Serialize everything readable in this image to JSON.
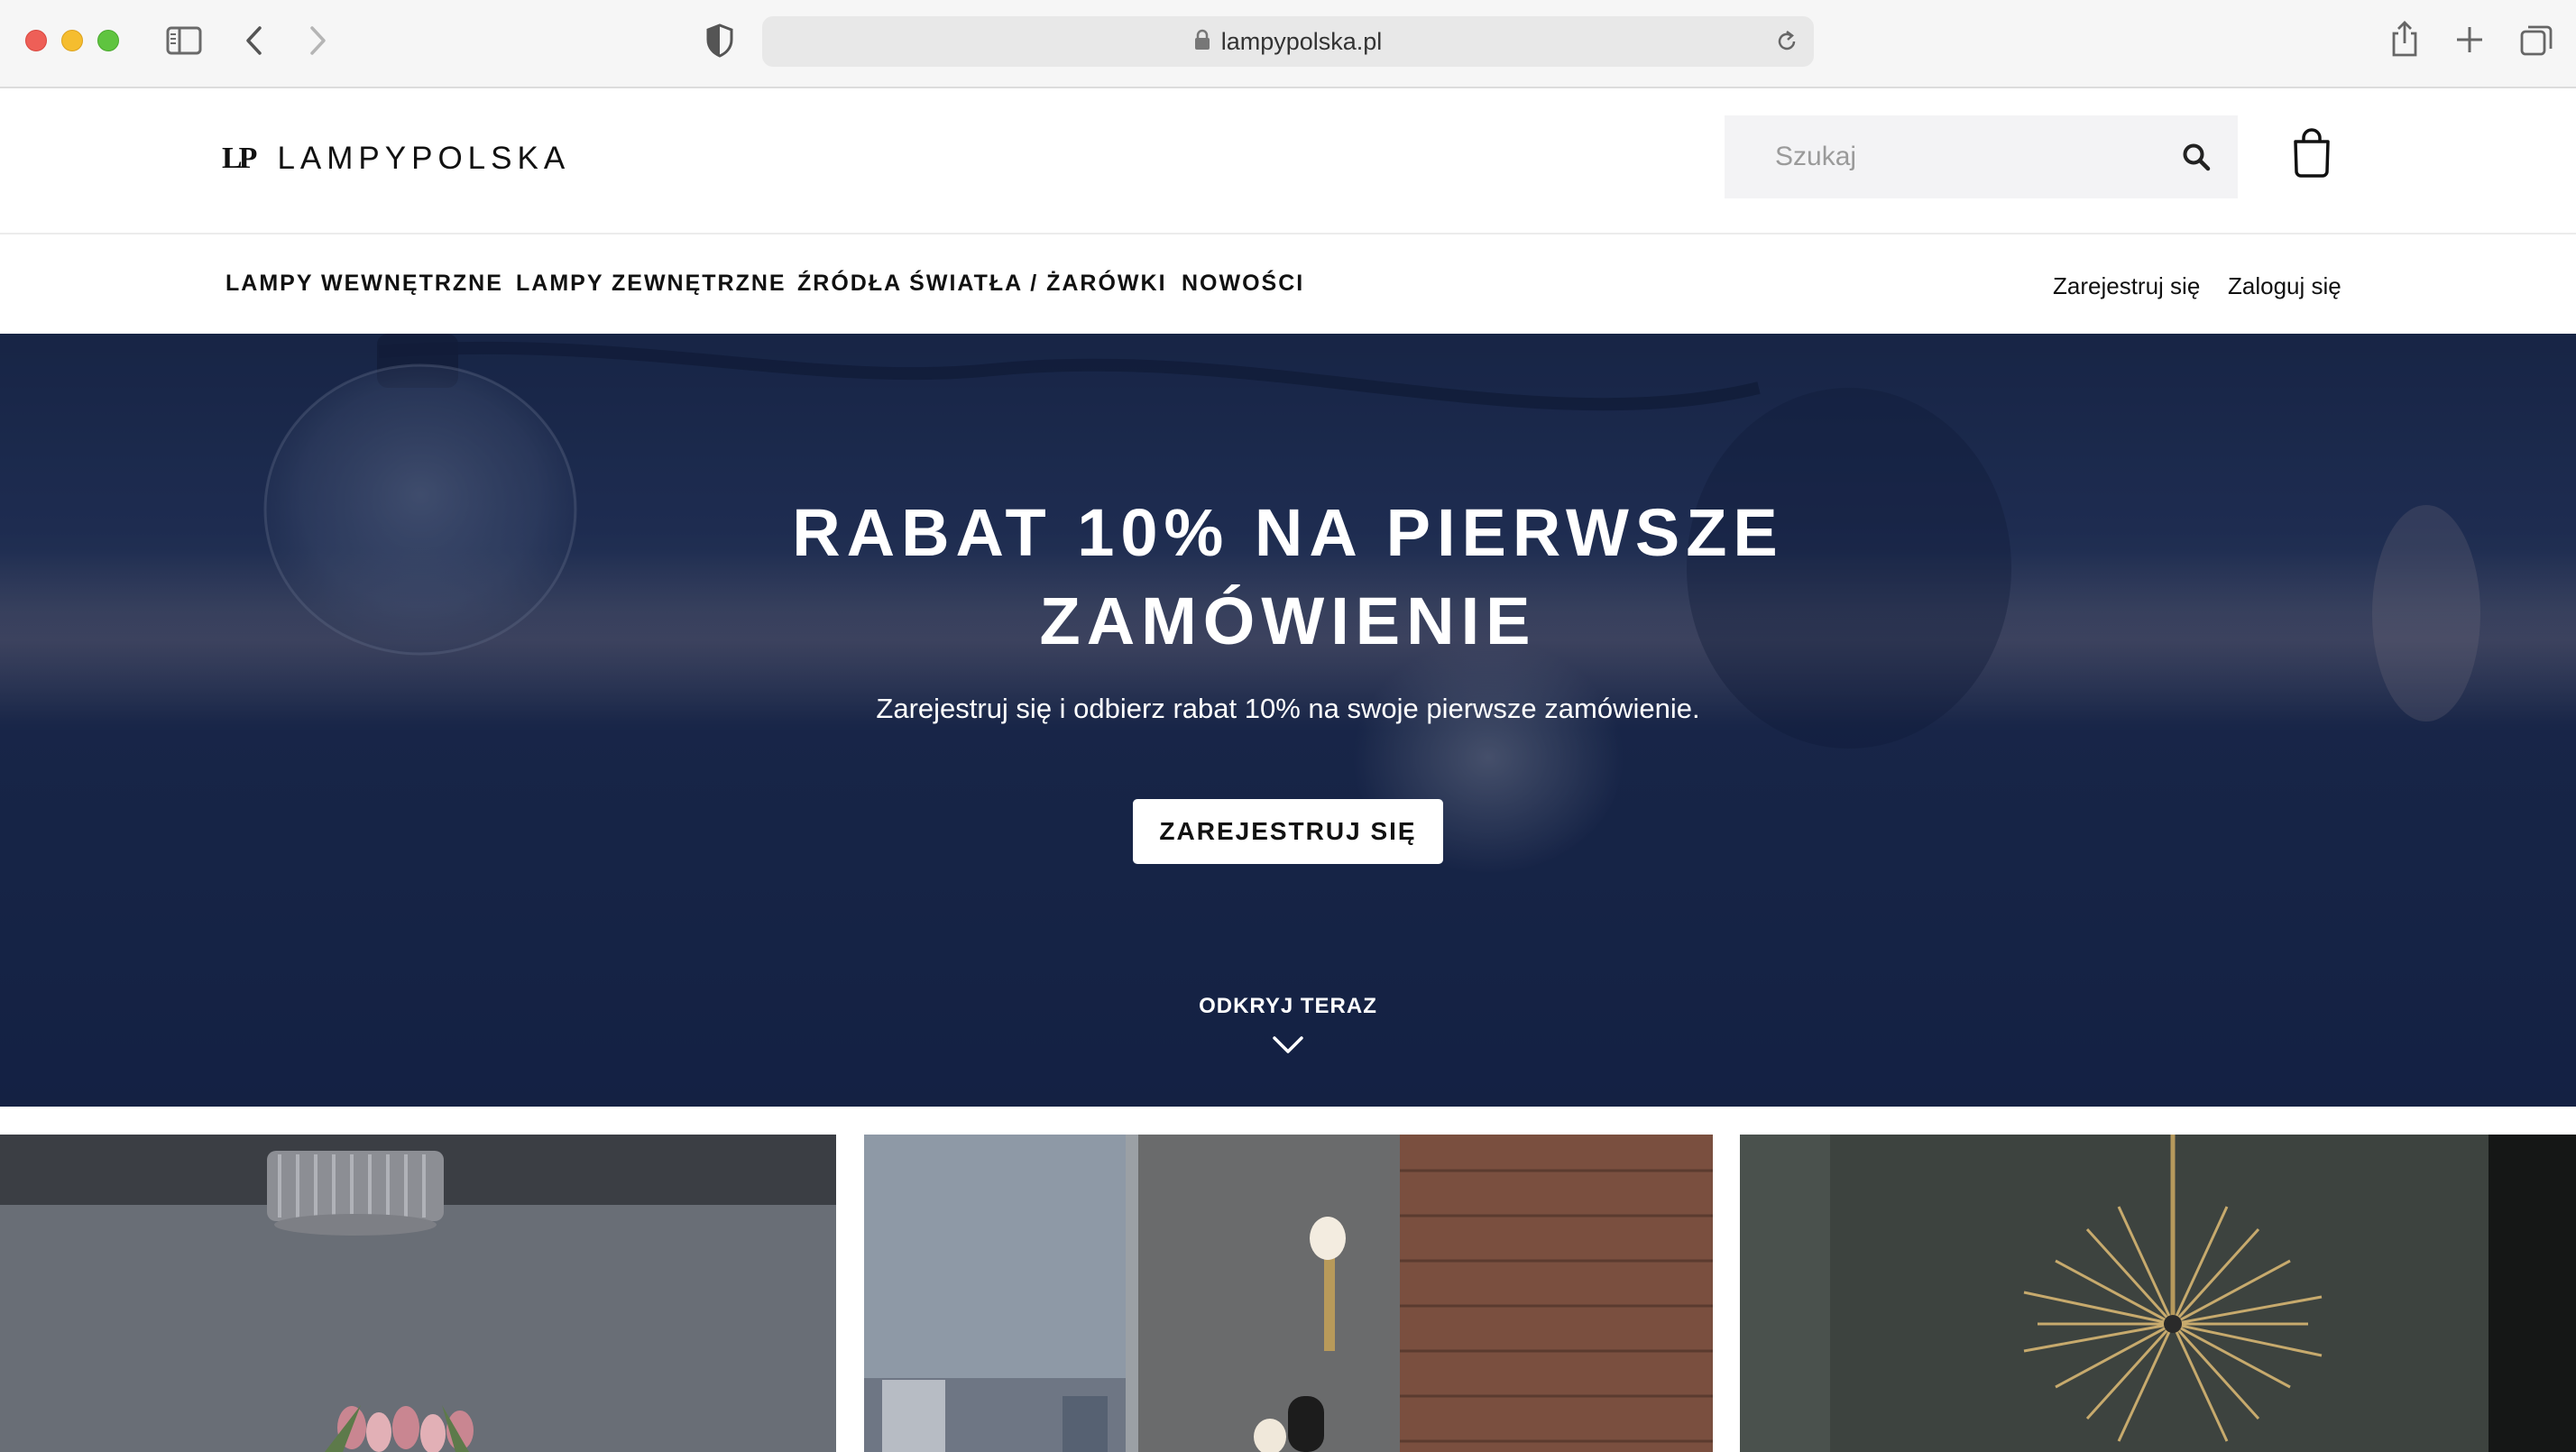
{
  "browser": {
    "url": "lampypolska.pl"
  },
  "header": {
    "logo_mark": "LP",
    "logo_text": "LAMPYPOLSKA",
    "search_placeholder": "Szukaj"
  },
  "nav": {
    "items": [
      {
        "label": "LAMPY WEWNĘTRZNE"
      },
      {
        "label": "LAMPY ZEWNĘTRZNE"
      },
      {
        "label": "ŹRÓDŁA ŚWIATŁA / ŻARÓWKI"
      },
      {
        "label": "NOWOŚCI"
      }
    ],
    "register": "Zarejestruj się",
    "login": "Zaloguj się"
  },
  "hero": {
    "title_line1": "RABAT 10% NA PIERWSZE",
    "title_line2": "ZAMÓWIENIE",
    "subtitle": "Zarejestruj się i odbierz rabat 10% na swoje pierwsze zamówienie.",
    "cta": "ZAREJESTRUJ SIĘ",
    "discover": "ODKRYJ TERAZ"
  },
  "icons": {
    "sidebar": "sidebar-icon",
    "back": "chevron-left-icon",
    "forward": "chevron-right-icon",
    "privacy": "shield-icon",
    "lock": "lock-icon",
    "reload": "reload-icon",
    "share": "share-icon",
    "new_tab": "plus-icon",
    "tabs": "tabs-icon",
    "search": "search-icon",
    "cart": "shopping-bag-icon",
    "discover": "chevron-down-icon"
  },
  "colors": {
    "hero_bg": "#1b2a4e",
    "button_bg": "#ffffff",
    "text_dark": "#111111"
  }
}
